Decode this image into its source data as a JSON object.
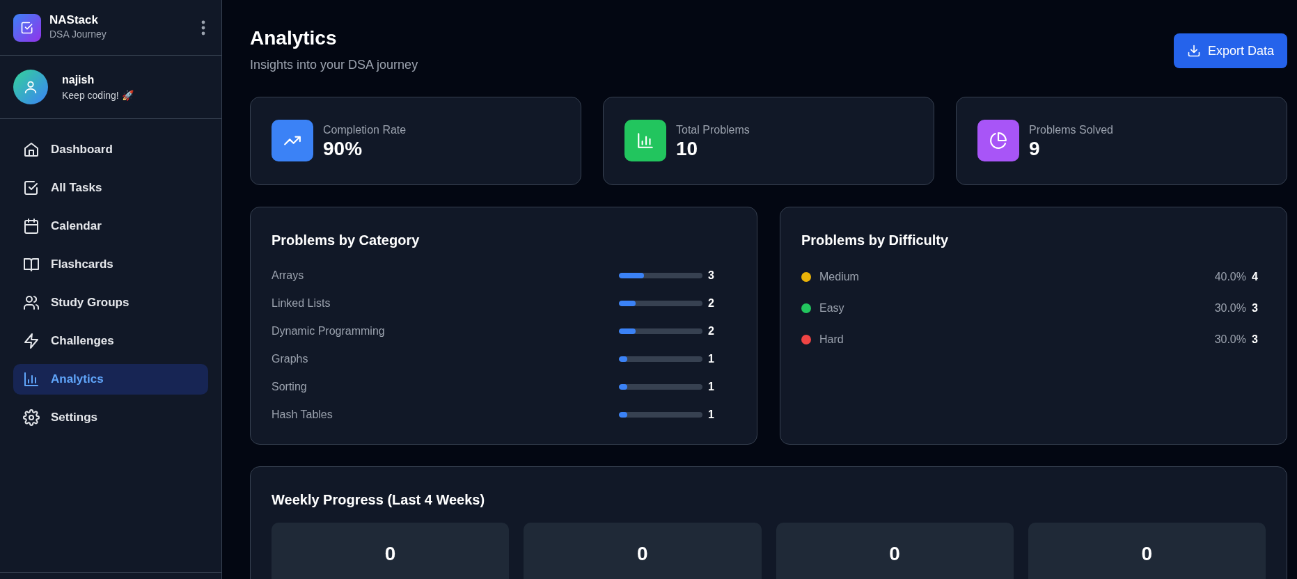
{
  "brand": {
    "name": "NAStack",
    "tagline": "DSA Journey"
  },
  "user": {
    "name": "najish",
    "status": "Keep coding! 🚀"
  },
  "sidebar": {
    "items": [
      {
        "label": "Dashboard",
        "selected": false
      },
      {
        "label": "All Tasks",
        "selected": false
      },
      {
        "label": "Calendar",
        "selected": false
      },
      {
        "label": "Flashcards",
        "selected": false
      },
      {
        "label": "Study Groups",
        "selected": false
      },
      {
        "label": "Challenges",
        "selected": false
      },
      {
        "label": "Analytics",
        "selected": true
      },
      {
        "label": "Settings",
        "selected": false
      }
    ]
  },
  "header": {
    "title": "Analytics",
    "subtitle": "Insights into your DSA journey",
    "export_button": "Export Data"
  },
  "stats": [
    {
      "label": "Completion Rate",
      "value": "90%",
      "color": "#3b82f6"
    },
    {
      "label": "Total Problems",
      "value": "10",
      "color": "#22c55e"
    },
    {
      "label": "Problems Solved",
      "value": "9",
      "color": "#a855f7"
    }
  ],
  "categories": {
    "title": "Problems by Category",
    "rows": [
      {
        "name": "Arrays",
        "level": 0.3,
        "count": "3"
      },
      {
        "name": "Linked Lists",
        "level": 0.2,
        "count": "2"
      },
      {
        "name": "Dynamic Programming",
        "level": 0.2,
        "count": "2"
      },
      {
        "name": "Graphs",
        "level": 0.1,
        "count": "1"
      },
      {
        "name": "Sorting",
        "level": 0.1,
        "count": "1"
      },
      {
        "name": "Hash Tables",
        "level": 0.1,
        "count": "1"
      }
    ]
  },
  "difficulty": {
    "title": "Problems by Difficulty",
    "rows": [
      {
        "name": "Medium",
        "color": "#eab308",
        "percent": "40.0%",
        "count": "4"
      },
      {
        "name": "Easy",
        "color": "#22c55e",
        "percent": "30.0%",
        "count": "3"
      },
      {
        "name": "Hard",
        "color": "#ef4444",
        "percent": "30.0%",
        "count": "3"
      }
    ]
  },
  "weekly": {
    "title": "Weekly Progress (Last 4 Weeks)",
    "weeks": [
      {
        "value": "0"
      },
      {
        "value": "0"
      },
      {
        "value": "0"
      },
      {
        "value": "0"
      }
    ]
  }
}
